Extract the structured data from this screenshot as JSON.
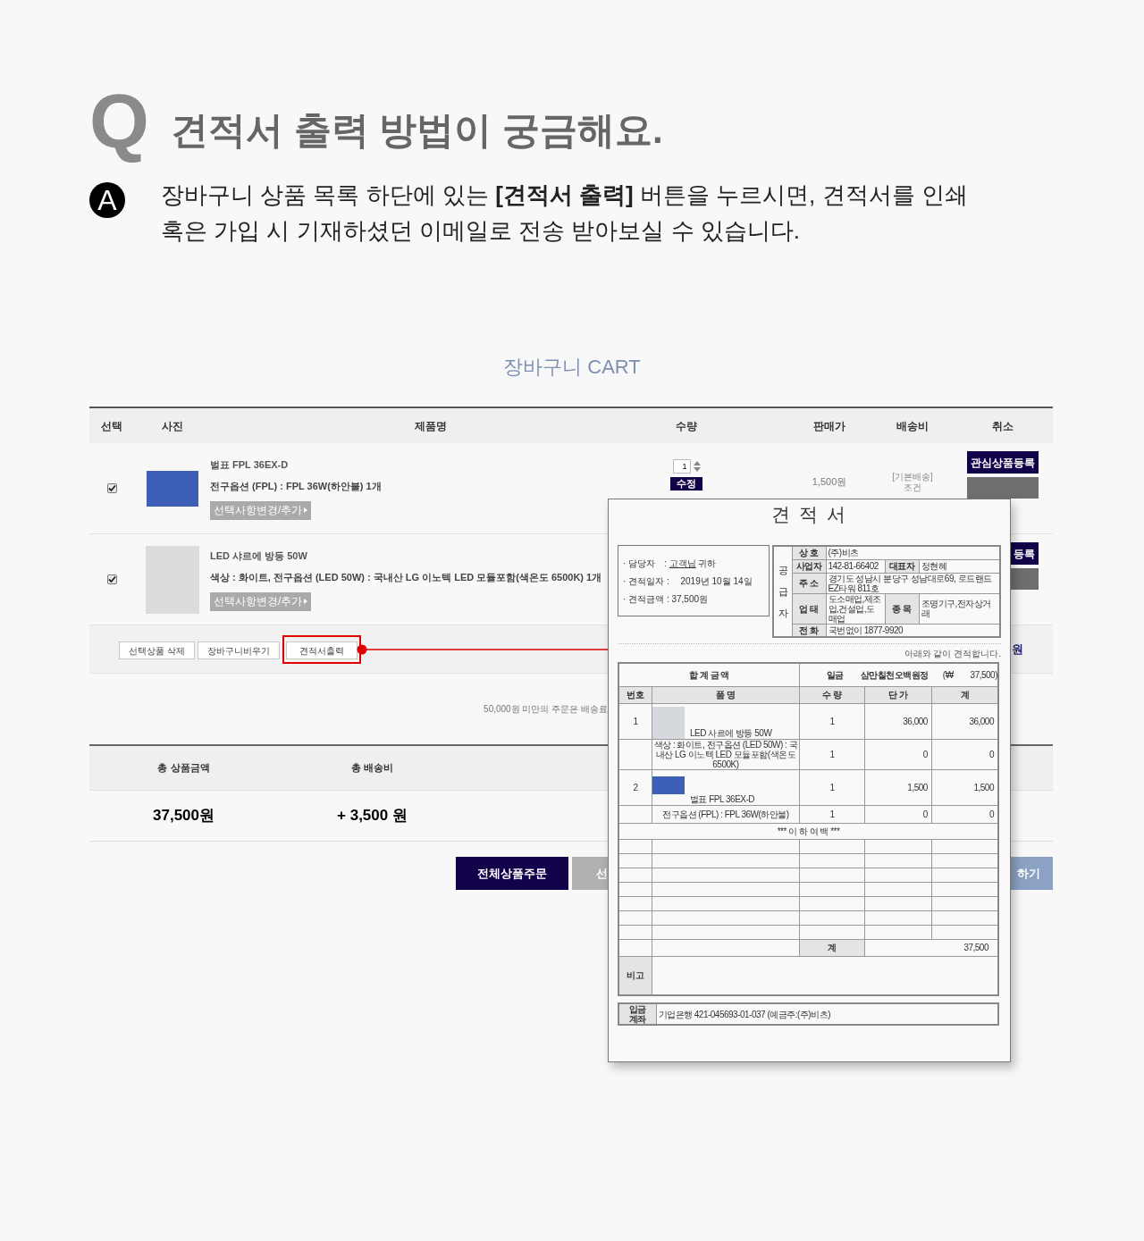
{
  "faq": {
    "q_mark": "Q",
    "question": "견적서 출력 방법이 궁금해요.",
    "a_mark": "A",
    "answer": "장바구니 상품 목록 하단에 있는 **[견적서 출력]** 버튼을 누르시면, 견적서를 인쇄 혹은 가입 시 기재하셨던 이메일로 전송 받아보실 수 있습니다."
  },
  "cart": {
    "title": "장바구니 CART",
    "columns": [
      "선택",
      "사진",
      "제품명",
      "수량",
      "판매가",
      "배송비",
      "취소"
    ],
    "rows": [
      {
        "checked": true,
        "name": "벌표 FPL 36EX-D",
        "option": "전구옵션 (FPL) : FPL 36W(하안불) 1개",
        "option_button": "선택사항변경/추가",
        "quantity": "1",
        "update_button": "수정",
        "price": "1,500원",
        "shipping": [
          "[기본배송]",
          "조건"
        ],
        "wish_button": "관심상품등록"
      },
      {
        "checked": true,
        "name": "LED 샤르에 방등 50W",
        "option": "색상 : 화이트, 전구옵션 (LED 50W) : 국내산 LG 이노텍 LED 모듈포함(색온도 6500K) 1개",
        "option_button": "선택사항변경/추가",
        "wish_button": "등록"
      }
    ],
    "actions": [
      {
        "label": "선택상품 삭제",
        "highlighted": false
      },
      {
        "label": "장바구니비우기",
        "highlighted": false
      },
      {
        "label": "견적서출력",
        "highlighted": true
      }
    ],
    "total_tail": "원",
    "notice": "50,000원 미만의 주문은 배송료",
    "summary": {
      "columns": [
        "총 상품금액",
        "총 배송비"
      ],
      "values": [
        "37,500원",
        "+ 3,500 원"
      ]
    },
    "buttons": [
      {
        "label": "전체상품주문",
        "kind": "primary"
      },
      {
        "label": "선",
        "kind": "secondary"
      },
      {
        "label": "하기",
        "kind": "accent"
      }
    ]
  },
  "quote": {
    "title": "견 적 서",
    "info": [
      {
        "label": "· 담당자　:",
        "value": "고객님",
        "suffix": "귀하",
        "underline": true
      },
      {
        "label": "· 견적일자 :",
        "value": "　2019년 10월 14일",
        "underline": false
      },
      {
        "label": "· 견적금액 :",
        "value": "37,500원",
        "underline": false
      }
    ],
    "supplier_label": "공급자",
    "supplier": [
      {
        "label": "상 호",
        "value": "(주)비츠"
      },
      {
        "label": "사업자",
        "value": "142-81-66402",
        "label2": "대표자",
        "value2": "정현혜"
      },
      {
        "label": "주 소",
        "value": "경기도 성남시 분당구 성남대로69, 로드랜드 EZ타워 811호"
      },
      {
        "label": "업 태",
        "value": "도소매업,제조업,건설업,도매업",
        "label2": "종 목",
        "value2": "조명기구,전자상거래"
      },
      {
        "label": "전 화",
        "value": "국번없이 1877-9920"
      }
    ],
    "note": "아래와 같이 견적합니다.",
    "total": {
      "label": "합 계 금 액",
      "words": "일금　　삼만칠천오백원정",
      "figure": "(₩　　37,500)"
    },
    "columns": [
      "번호",
      "품 명",
      "수 량",
      "단 가",
      "계"
    ],
    "lines": [
      {
        "kind": "product",
        "no": "1",
        "name": "LED 사르에 방등 50W",
        "qty": "1",
        "unit": "36,000",
        "total": "36,000"
      },
      {
        "kind": "option",
        "name": "색상 : 화이트, 전구옵션 (LED 50W) : 국내산 LG 이노텍 LED 모듈포함(색온도 6500K)",
        "qty": "1",
        "unit": "0",
        "total": "0"
      },
      {
        "kind": "product",
        "no": "2",
        "name": "벌표 FPL 36EX-D",
        "qty": "1",
        "unit": "1,500",
        "total": "1,500"
      },
      {
        "kind": "option",
        "name": "전구옵션 (FPL) : FPL 36W(하안불)",
        "qty": "1",
        "unit": "0",
        "total": "0"
      }
    ],
    "end_mark": "*** 이 하 여 백 ***",
    "sum": {
      "label": "계",
      "value": "37,500"
    },
    "remarks_label": "비고",
    "account": {
      "label": "입금 계좌",
      "value": "기업은행 421-045693-01-037 (예금주:(주)비츠)"
    }
  }
}
